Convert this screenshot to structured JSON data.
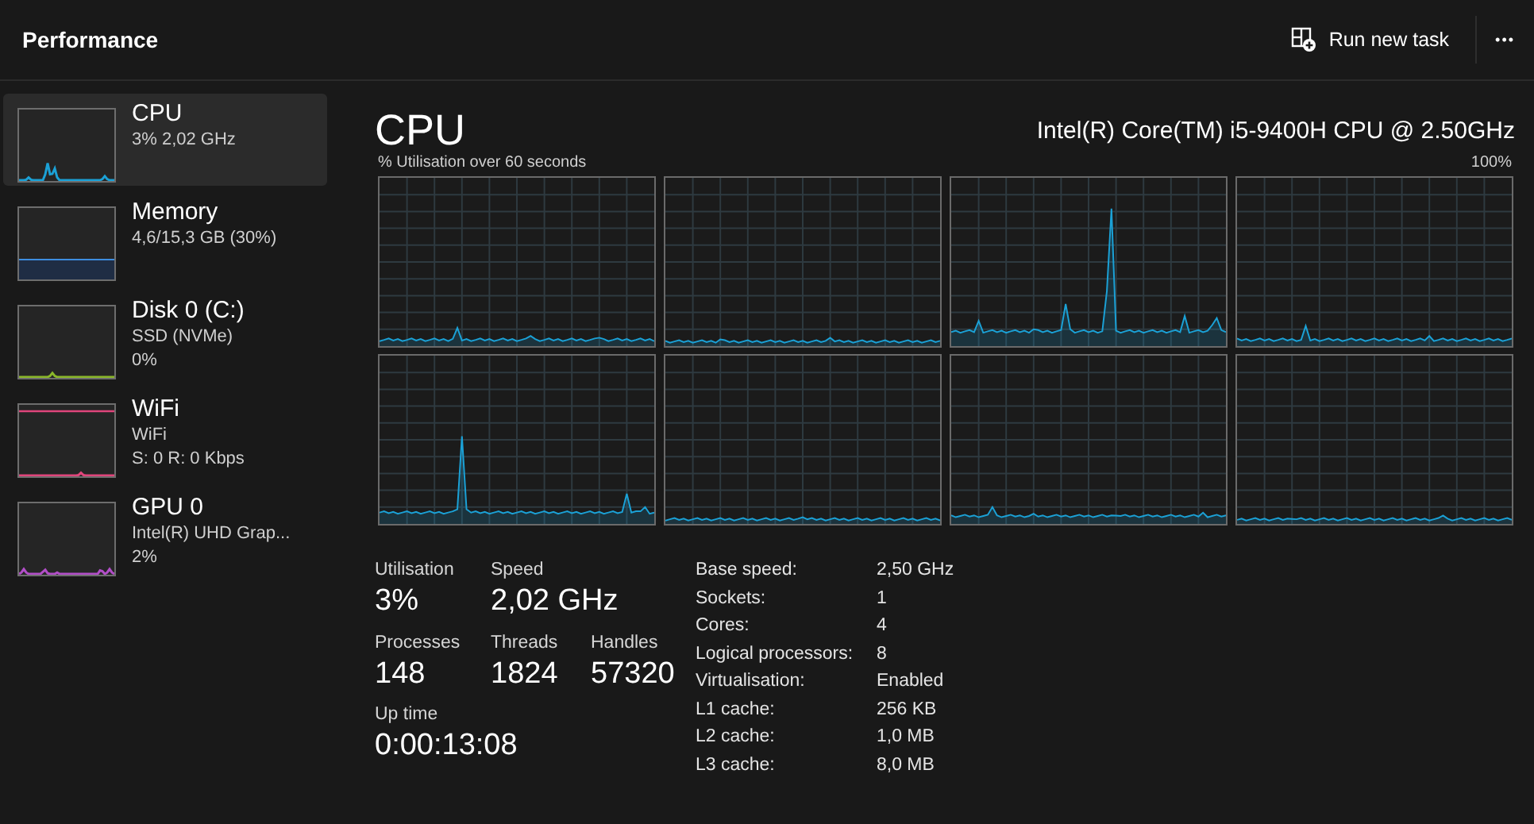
{
  "header": {
    "title": "Performance",
    "run_task": "Run new task",
    "more": "•••"
  },
  "sidebar": {
    "items": [
      {
        "name": "CPU",
        "lines": [
          "3% 2,02 GHz"
        ],
        "selected": true,
        "kind": "sparkline",
        "color": "#1ba1d6"
      },
      {
        "name": "Memory",
        "lines": [
          "4,6/15,3 GB (30%)"
        ],
        "selected": false,
        "kind": "meter",
        "color": "#3d8ee0"
      },
      {
        "name": "Disk 0 (C:)",
        "lines": [
          "SSD (NVMe)",
          "0%"
        ],
        "selected": false,
        "kind": "sparkline",
        "color": "#8bb82a"
      },
      {
        "name": "WiFi",
        "lines": [
          "WiFi",
          "S: 0 R: 0 Kbps"
        ],
        "selected": false,
        "kind": "sparkline",
        "color": "#e0457b"
      },
      {
        "name": "GPU 0",
        "lines": [
          "Intel(R) UHD Grap...",
          "2%"
        ],
        "selected": false,
        "kind": "sparkline",
        "color": "#b24ec8"
      }
    ]
  },
  "main": {
    "title": "CPU",
    "model": "Intel(R) Core(TM) i5-9400H CPU @ 2.50GHz",
    "graph_label": "% Utilisation over 60 seconds",
    "graph_max": "100%",
    "stats": [
      [
        {
          "label": "Utilisation",
          "value": "3%"
        },
        {
          "label": "Speed",
          "value": "2,02 GHz"
        }
      ],
      [
        {
          "label": "Processes",
          "value": "148"
        },
        {
          "label": "Threads",
          "value": "1824"
        },
        {
          "label": "Handles",
          "value": "57320"
        }
      ],
      [
        {
          "label": "Up time",
          "value": "0:00:13:08"
        }
      ]
    ],
    "specs": [
      {
        "label": "Base speed:",
        "value": "2,50 GHz"
      },
      {
        "label": "Sockets:",
        "value": "1"
      },
      {
        "label": "Cores:",
        "value": "4"
      },
      {
        "label": "Logical processors:",
        "value": "8"
      },
      {
        "label": "Virtualisation:",
        "value": "Enabled"
      },
      {
        "label": "L1 cache:",
        "value": "256 KB"
      },
      {
        "label": "L2 cache:",
        "value": "1,0 MB"
      },
      {
        "label": "L3 cache:",
        "value": "8,0 MB"
      }
    ]
  }
}
